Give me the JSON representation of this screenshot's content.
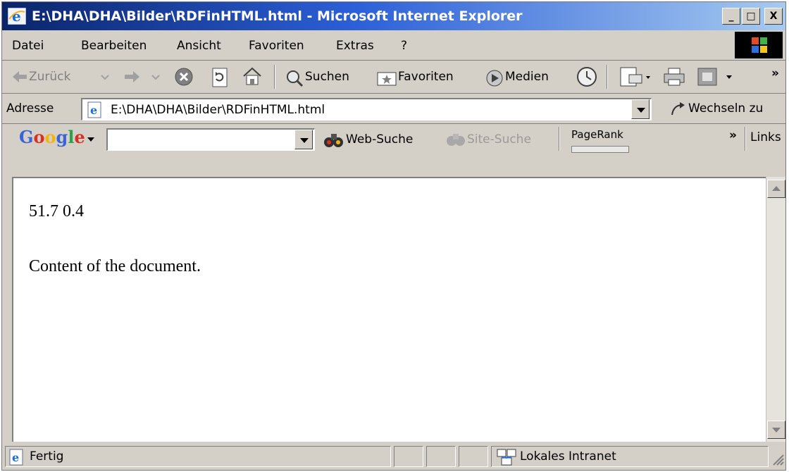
{
  "window": {
    "title": "E:\\DHA\\DHA\\Bilder\\RDFinHTML.html - Microsoft Internet Explorer",
    "controls": {
      "minimize": "_",
      "maximize": "□",
      "close": "X"
    }
  },
  "menu": [
    "Datei",
    "Bearbeiten",
    "Ansicht",
    "Favoriten",
    "Extras",
    "?"
  ],
  "toolbar": {
    "back": "Zurück",
    "search": "Suchen",
    "favorites": "Favoriten",
    "media": "Medien",
    "more": "»"
  },
  "address": {
    "label": "Adresse",
    "value": "E:\\DHA\\DHA\\Bilder\\RDFinHTML.html",
    "go": "Wechseln zu"
  },
  "googlebar": {
    "logo_letters": [
      "G",
      "o",
      "o",
      "g",
      "l",
      "e"
    ],
    "logo_colors": [
      "#3a64d6",
      "#d93025",
      "#f2b50f",
      "#3a64d6",
      "#2aa14a",
      "#d93025"
    ],
    "search_value": "",
    "web_search": "Web-Suche",
    "site_search": "Site-Suche",
    "pagerank": "PageRank",
    "more": "»",
    "links": "Links"
  },
  "document": {
    "line1": "51.7 0.4",
    "line2": "Content of the document."
  },
  "status": {
    "text": "Fertig",
    "zone": "Lokales Intranet"
  }
}
